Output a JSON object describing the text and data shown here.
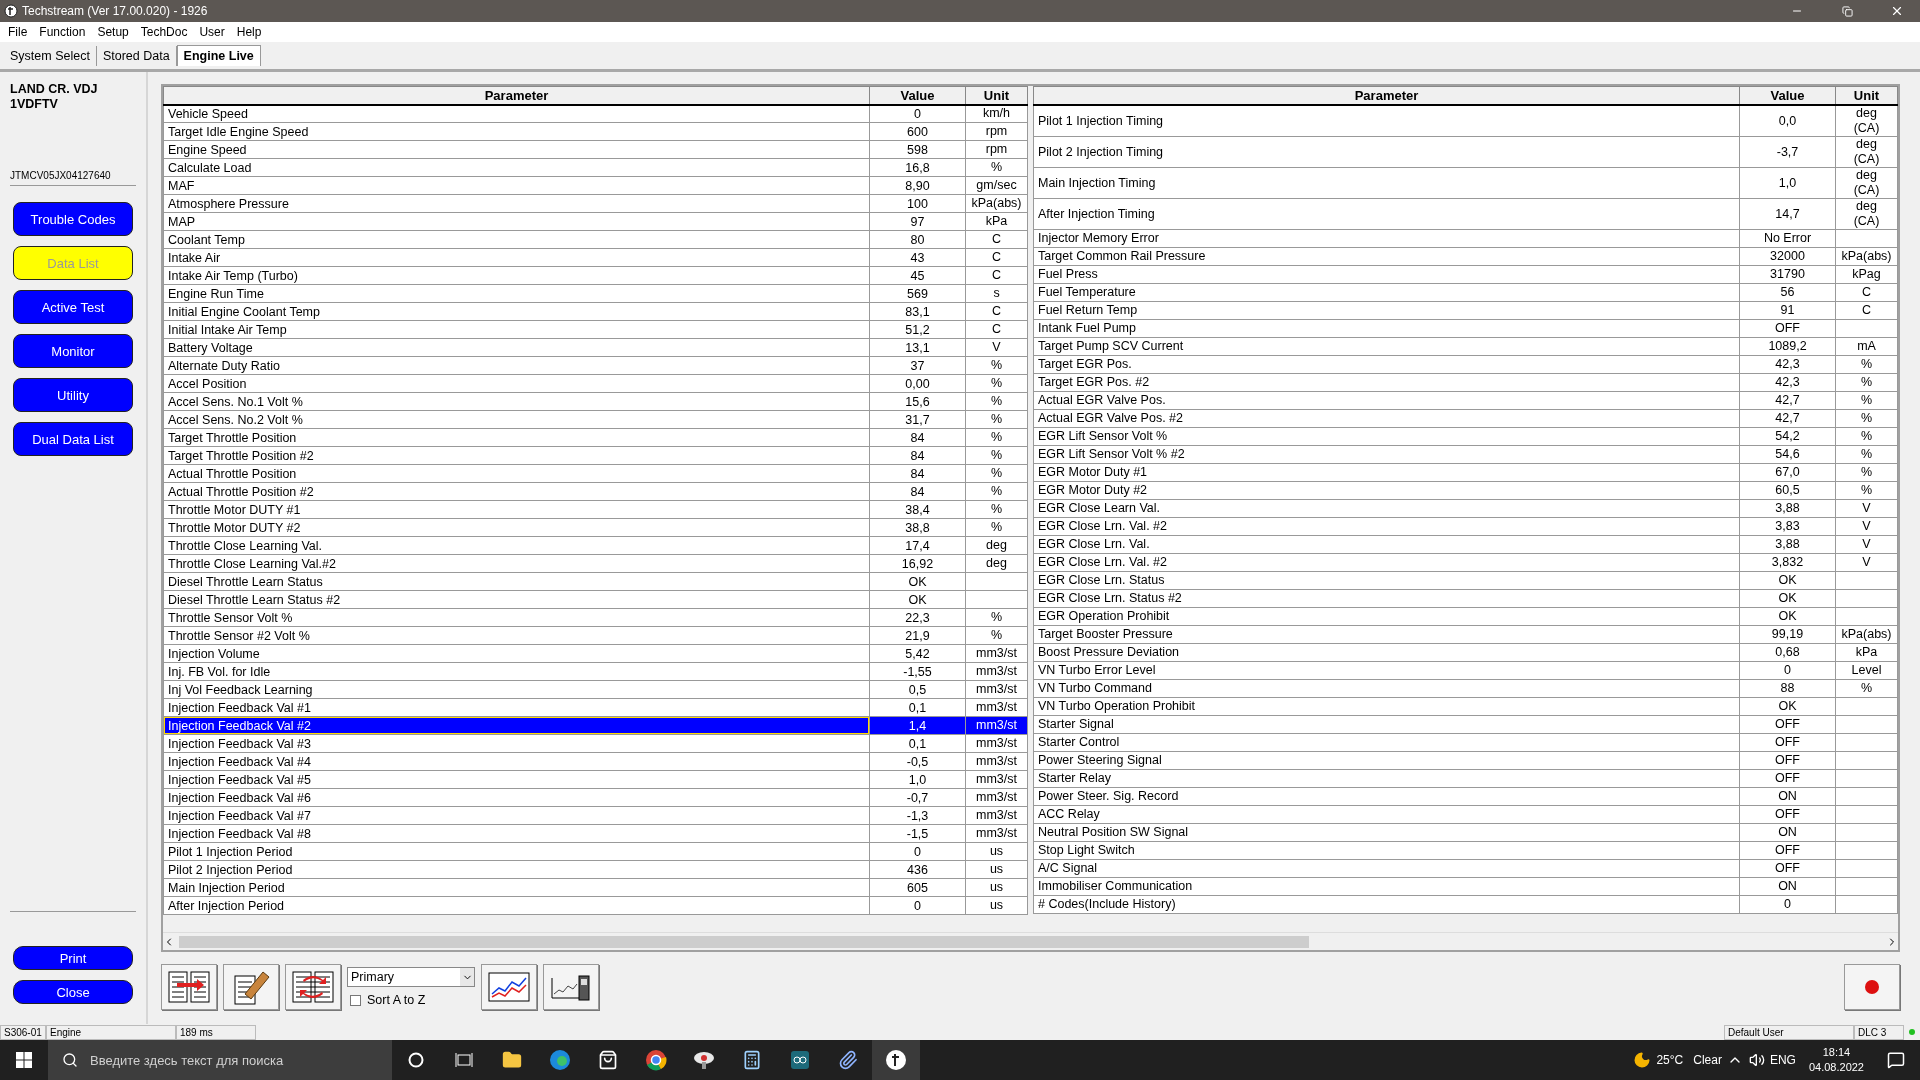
{
  "window": {
    "title": "Techstream (Ver 17.00.020) - 1926"
  },
  "menu": [
    "File",
    "Function",
    "Setup",
    "TechDoc",
    "User",
    "Help"
  ],
  "tabs": [
    {
      "label": "System Select",
      "selected": false
    },
    {
      "label": "Stored Data",
      "selected": false
    },
    {
      "label": "Engine Live",
      "selected": true
    }
  ],
  "sidebar": {
    "vehicle": [
      "LAND CR. VDJ",
      "1VDFTV"
    ],
    "vin": "JTMCV05JX04127640",
    "buttons": [
      {
        "label": "Trouble Codes",
        "selected": false
      },
      {
        "label": "Data List",
        "selected": true
      },
      {
        "label": "Active Test",
        "selected": false
      },
      {
        "label": "Monitor",
        "selected": false
      },
      {
        "label": "Utility",
        "selected": false
      },
      {
        "label": "Dual Data List",
        "selected": false
      }
    ],
    "bottom_buttons": [
      "Print",
      "Close"
    ]
  },
  "tables": [
    {
      "columns": [
        "Parameter",
        "Value",
        "Unit"
      ],
      "rows": [
        {
          "parameter": "Vehicle Speed",
          "value": "0",
          "unit": "km/h",
          "selected": false
        },
        {
          "parameter": "Target Idle Engine Speed",
          "value": "600",
          "unit": "rpm",
          "selected": false
        },
        {
          "parameter": "Engine Speed",
          "value": "598",
          "unit": "rpm",
          "selected": false
        },
        {
          "parameter": "Calculate Load",
          "value": "16,8",
          "unit": "%",
          "selected": false
        },
        {
          "parameter": "MAF",
          "value": "8,90",
          "unit": "gm/sec",
          "selected": false
        },
        {
          "parameter": "Atmosphere Pressure",
          "value": "100",
          "unit": "kPa(abs)",
          "selected": false
        },
        {
          "parameter": "MAP",
          "value": "97",
          "unit": "kPa",
          "selected": false
        },
        {
          "parameter": "Coolant Temp",
          "value": "80",
          "unit": "C",
          "selected": false
        },
        {
          "parameter": "Intake Air",
          "value": "43",
          "unit": "C",
          "selected": false
        },
        {
          "parameter": "Intake Air Temp (Turbo)",
          "value": "45",
          "unit": "C",
          "selected": false
        },
        {
          "parameter": "Engine Run Time",
          "value": "569",
          "unit": "s",
          "selected": false
        },
        {
          "parameter": "Initial Engine Coolant Temp",
          "value": "83,1",
          "unit": "C",
          "selected": false
        },
        {
          "parameter": "Initial Intake Air Temp",
          "value": "51,2",
          "unit": "C",
          "selected": false
        },
        {
          "parameter": "Battery Voltage",
          "value": "13,1",
          "unit": "V",
          "selected": false
        },
        {
          "parameter": "Alternate Duty Ratio",
          "value": "37",
          "unit": "%",
          "selected": false
        },
        {
          "parameter": "Accel Position",
          "value": "0,00",
          "unit": "%",
          "selected": false
        },
        {
          "parameter": "Accel Sens. No.1 Volt %",
          "value": "15,6",
          "unit": "%",
          "selected": false
        },
        {
          "parameter": "Accel Sens. No.2 Volt %",
          "value": "31,7",
          "unit": "%",
          "selected": false
        },
        {
          "parameter": "Target Throttle Position",
          "value": "84",
          "unit": "%",
          "selected": false
        },
        {
          "parameter": "Target Throttle Position #2",
          "value": "84",
          "unit": "%",
          "selected": false
        },
        {
          "parameter": "Actual Throttle Position",
          "value": "84",
          "unit": "%",
          "selected": false
        },
        {
          "parameter": "Actual Throttle Position #2",
          "value": "84",
          "unit": "%",
          "selected": false
        },
        {
          "parameter": "Throttle Motor DUTY #1",
          "value": "38,4",
          "unit": "%",
          "selected": false
        },
        {
          "parameter": "Throttle Motor DUTY #2",
          "value": "38,8",
          "unit": "%",
          "selected": false
        },
        {
          "parameter": "Throttle Close Learning Val.",
          "value": "17,4",
          "unit": "deg",
          "selected": false
        },
        {
          "parameter": "Throttle Close Learning Val.#2",
          "value": "16,92",
          "unit": "deg",
          "selected": false
        },
        {
          "parameter": "Diesel Throttle Learn Status",
          "value": "OK",
          "selected": false
        },
        {
          "parameter": "Diesel Throttle Learn Status #2",
          "value": "OK",
          "selected": false
        },
        {
          "parameter": "Throttle Sensor Volt %",
          "value": "22,3",
          "unit": "%",
          "selected": false
        },
        {
          "parameter": "Throttle Sensor #2 Volt %",
          "value": "21,9",
          "unit": "%",
          "selected": false
        },
        {
          "parameter": "Injection Volume",
          "value": "5,42",
          "unit": "mm3/st",
          "selected": false
        },
        {
          "parameter": "Inj. FB Vol. for Idle",
          "value": "-1,55",
          "unit": "mm3/st",
          "selected": false
        },
        {
          "parameter": "Inj Vol Feedback Learning",
          "value": "0,5",
          "unit": "mm3/st",
          "selected": false
        },
        {
          "parameter": "Injection Feedback Val #1",
          "value": "0,1",
          "unit": "mm3/st",
          "selected": false
        },
        {
          "parameter": "Injection Feedback Val #2",
          "value": "1,4",
          "unit": "mm3/st",
          "selected": true
        },
        {
          "parameter": "Injection Feedback Val #3",
          "value": "0,1",
          "unit": "mm3/st",
          "selected": false
        },
        {
          "parameter": "Injection Feedback Val #4",
          "value": "-0,5",
          "unit": "mm3/st",
          "selected": false
        },
        {
          "parameter": "Injection Feedback Val #5",
          "value": "1,0",
          "unit": "mm3/st",
          "selected": false
        },
        {
          "parameter": "Injection Feedback Val #6",
          "value": "-0,7",
          "unit": "mm3/st",
          "selected": false
        },
        {
          "parameter": "Injection Feedback Val #7",
          "value": "-1,3",
          "unit": "mm3/st",
          "selected": false
        },
        {
          "parameter": "Injection Feedback Val #8",
          "value": "-1,5",
          "unit": "mm3/st",
          "selected": false
        },
        {
          "parameter": "Pilot 1 Injection Period",
          "value": "0",
          "unit": "us",
          "selected": false
        },
        {
          "parameter": "Pilot 2 Injection Period",
          "value": "436",
          "unit": "us",
          "selected": false
        },
        {
          "parameter": "Main Injection Period",
          "value": "605",
          "unit": "us",
          "selected": false
        },
        {
          "parameter": "After Injection Period",
          "value": "0",
          "unit": "us",
          "selected": false
        }
      ]
    },
    {
      "columns": [
        "Parameter",
        "Value",
        "Unit"
      ],
      "rows": [
        {
          "parameter": "Pilot 1 Injection Timing",
          "value": "0,0",
          "unit": "deg (CA)",
          "selected": false
        },
        {
          "parameter": "Pilot 2 Injection Timing",
          "value": "-3,7",
          "unit": "deg (CA)",
          "selected": false
        },
        {
          "parameter": "Main Injection Timing",
          "value": "1,0",
          "unit": "deg (CA)",
          "selected": false
        },
        {
          "parameter": "After Injection Timing",
          "value": "14,7",
          "unit": "deg (CA)",
          "selected": false
        },
        {
          "parameter": "Injector Memory Error",
          "value": "No Error",
          "selected": false
        },
        {
          "parameter": "Target Common Rail Pressure",
          "value": "32000",
          "unit": "kPa(abs)",
          "selected": false
        },
        {
          "parameter": "Fuel Press",
          "value": "31790",
          "unit": "kPag",
          "selected": false
        },
        {
          "parameter": "Fuel Temperature",
          "value": "56",
          "unit": "C",
          "selected": false
        },
        {
          "parameter": "Fuel Return Temp",
          "value": "91",
          "unit": "C",
          "selected": false
        },
        {
          "parameter": "Intank Fuel Pump",
          "value": "OFF",
          "selected": false
        },
        {
          "parameter": "Target Pump SCV Current",
          "value": "1089,2",
          "unit": "mA",
          "selected": false
        },
        {
          "parameter": "Target EGR Pos.",
          "value": "42,3",
          "unit": "%",
          "selected": false
        },
        {
          "parameter": "Target EGR Pos. #2",
          "value": "42,3",
          "unit": "%",
          "selected": false
        },
        {
          "parameter": "Actual EGR Valve Pos.",
          "value": "42,7",
          "unit": "%",
          "selected": false
        },
        {
          "parameter": "Actual EGR Valve Pos. #2",
          "value": "42,7",
          "unit": "%",
          "selected": false
        },
        {
          "parameter": "EGR Lift Sensor Volt %",
          "value": "54,2",
          "unit": "%",
          "selected": false
        },
        {
          "parameter": "EGR Lift Sensor Volt % #2",
          "value": "54,6",
          "unit": "%",
          "selected": false
        },
        {
          "parameter": "EGR Motor Duty #1",
          "value": "67,0",
          "unit": "%",
          "selected": false
        },
        {
          "parameter": "EGR Motor Duty #2",
          "value": "60,5",
          "unit": "%",
          "selected": false
        },
        {
          "parameter": "EGR Close Learn Val.",
          "value": "3,88",
          "unit": "V",
          "selected": false
        },
        {
          "parameter": "EGR Close Lrn. Val. #2",
          "value": "3,83",
          "unit": "V",
          "selected": false
        },
        {
          "parameter": "EGR Close Lrn. Val.",
          "value": "3,88",
          "unit": "V",
          "selected": false
        },
        {
          "parameter": "EGR Close Lrn. Val. #2",
          "value": "3,832",
          "unit": "V",
          "selected": false
        },
        {
          "parameter": "EGR Close Lrn. Status",
          "value": "OK",
          "selected": false
        },
        {
          "parameter": "EGR Close Lrn. Status #2",
          "value": "OK",
          "selected": false
        },
        {
          "parameter": "EGR Operation Prohibit",
          "value": "OK",
          "selected": false
        },
        {
          "parameter": "Target Booster Pressure",
          "value": "99,19",
          "unit": "kPa(abs)",
          "selected": false
        },
        {
          "parameter": "Boost Pressure Deviation",
          "value": "0,68",
          "unit": "kPa",
          "selected": false
        },
        {
          "parameter": "VN Turbo Error Level",
          "value": "0",
          "unit": "Level",
          "selected": false
        },
        {
          "parameter": "VN Turbo Command",
          "value": "88",
          "unit": "%",
          "selected": false
        },
        {
          "parameter": "VN Turbo Operation Prohibit",
          "value": "OK",
          "selected": false
        },
        {
          "parameter": "Starter Signal",
          "value": "OFF",
          "selected": false
        },
        {
          "parameter": "Starter Control",
          "value": "OFF",
          "selected": false
        },
        {
          "parameter": "Power Steering Signal",
          "value": "OFF",
          "selected": false
        },
        {
          "parameter": "Starter Relay",
          "value": "OFF",
          "selected": false
        },
        {
          "parameter": "Power Steer. Sig. Record",
          "value": "ON",
          "selected": false
        },
        {
          "parameter": "ACC Relay",
          "value": "OFF",
          "selected": false
        },
        {
          "parameter": "Neutral Position SW Signal",
          "value": "ON",
          "selected": false
        },
        {
          "parameter": "Stop Light Switch",
          "value": "OFF",
          "selected": false
        },
        {
          "parameter": "A/C Signal",
          "value": "OFF",
          "selected": false
        },
        {
          "parameter": "Immobiliser Communication",
          "value": "ON",
          "selected": false
        },
        {
          "parameter": "# Codes(Include History)",
          "value": "0",
          "selected": false
        }
      ]
    }
  ],
  "toolbar": {
    "dropdown": {
      "value": "Primary"
    },
    "sort": {
      "label": "Sort A to Z",
      "checked": false
    }
  },
  "status_bar": {
    "code": "S306-01",
    "system": "Engine",
    "timing": "189 ms",
    "user": "Default User",
    "connection": "DLC 3"
  },
  "taskbar": {
    "search": {
      "placeholder": "Введите здесь текст для поиска"
    },
    "temperature": "25°C",
    "weather": "Clear",
    "language": "ENG",
    "time": "18:14",
    "date": "04.08.2022"
  }
}
